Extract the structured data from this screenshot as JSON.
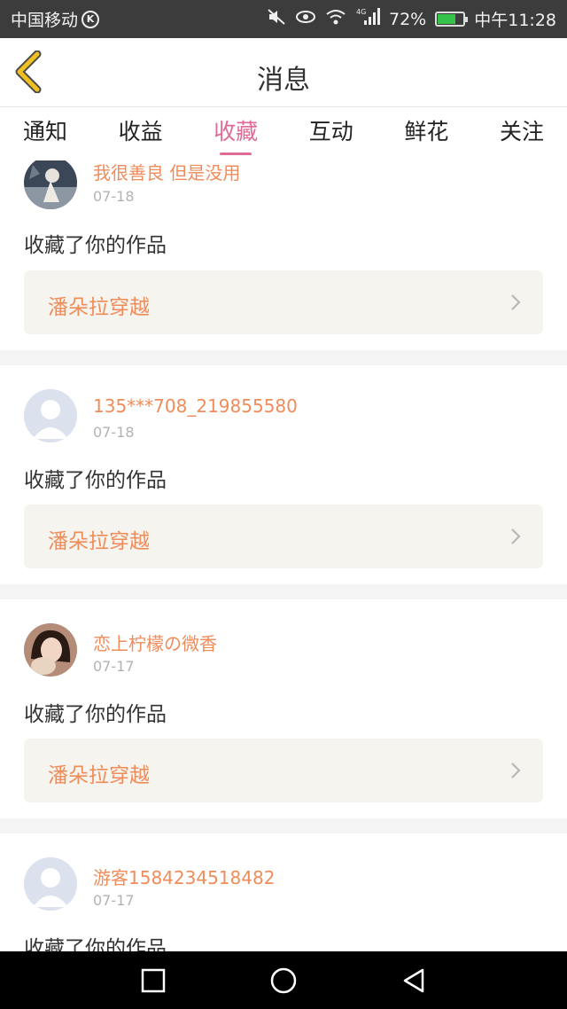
{
  "status": {
    "carrier": "中国移动",
    "carrier_badge": "K",
    "network": "4G",
    "battery_percent": "72%",
    "battery_level": 0.72,
    "time": "中午11:28"
  },
  "nav": {
    "title": "消息"
  },
  "tabs": [
    {
      "label": "通知"
    },
    {
      "label": "收益"
    },
    {
      "label": "收藏",
      "active": true
    },
    {
      "label": "互动"
    },
    {
      "label": "鲜花"
    },
    {
      "label": "关注"
    }
  ],
  "items": [
    {
      "username": "我很善良 但是没用",
      "date": "07-18",
      "action": "收藏了你的作品",
      "work": "潘朵拉穿越",
      "avatar": "photo-avatar"
    },
    {
      "username": "135***708_219855580",
      "date": "07-18",
      "action": "收藏了你的作品",
      "work": "潘朵拉穿越",
      "avatar": "default-avatar"
    },
    {
      "username": "恋上柠檬の微香",
      "date": "07-17",
      "action": "收藏了你的作品",
      "work": "潘朵拉穿越",
      "avatar": "photo-avatar"
    },
    {
      "username": "游客1584234518482",
      "date": "07-17",
      "action": "收藏了你的作品",
      "work": "",
      "avatar": "default-avatar"
    }
  ],
  "colors": {
    "accent_pink": "#e06a96",
    "username_orange": "#f08c5a",
    "back_arrow": "#f0c020",
    "status_bar": "#3c3c3c",
    "work_box": "#f6f4ee"
  },
  "icons": [
    "back-arrow-icon",
    "chevron-right-icon",
    "square-nav-icon",
    "circle-nav-icon",
    "triangle-back-nav-icon",
    "mute-icon",
    "eye-icon",
    "wifi-icon",
    "signal-icon",
    "battery-icon"
  ]
}
